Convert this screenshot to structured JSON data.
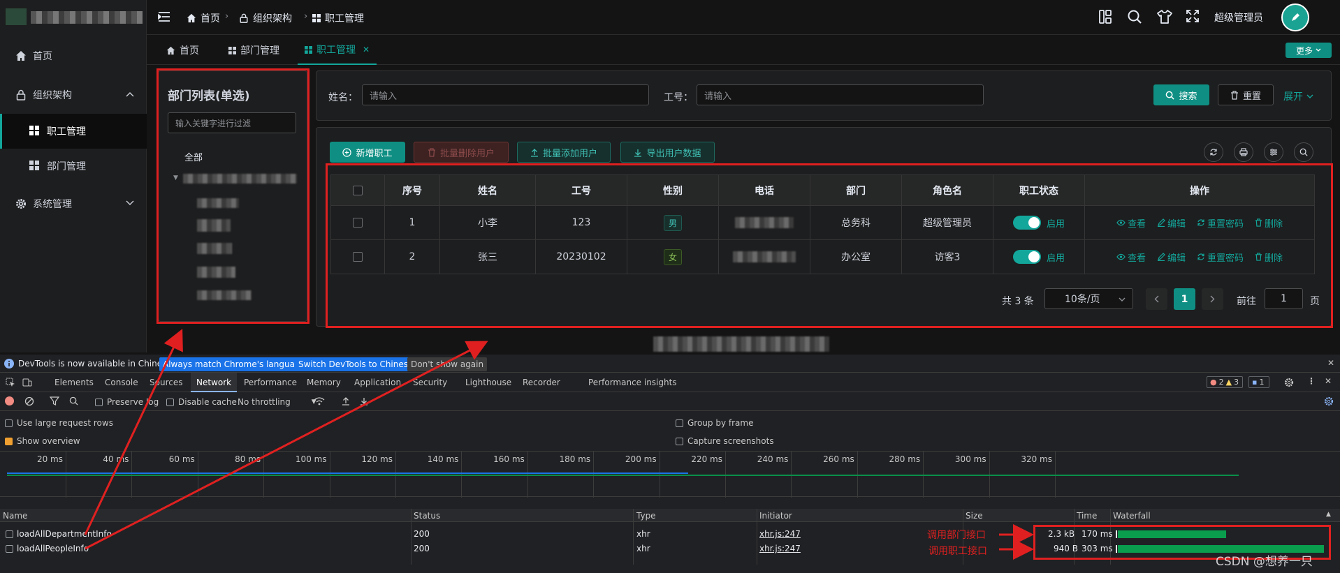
{
  "sidebar": {
    "items": [
      {
        "label": "首页",
        "icon": "home-icon"
      },
      {
        "label": "组织架构",
        "icon": "lock-icon"
      },
      {
        "label": "职工管理",
        "icon": "grid-icon"
      },
      {
        "label": "部门管理",
        "icon": "grid-icon"
      },
      {
        "label": "系统管理",
        "icon": "gear-icon"
      }
    ]
  },
  "header": {
    "breadcrumbs": [
      "首页",
      "组织架构",
      "职工管理"
    ],
    "user_name": "超级管理员"
  },
  "tabs": {
    "items": [
      "首页",
      "部门管理",
      "职工管理"
    ],
    "more_label": "更多"
  },
  "dept_panel": {
    "title": "部门列表(单选)",
    "filter_placeholder": "输入关键字进行过滤",
    "root_label": "全部"
  },
  "search": {
    "name_label": "姓名：",
    "name_placeholder": "请输入",
    "id_label": "工号：",
    "id_placeholder": "请输入",
    "search_label": "搜索",
    "reset_label": "重置",
    "expand_label": "展开"
  },
  "toolbar": {
    "add_label": "新增职工",
    "batch_delete_label": "批量删除用户",
    "batch_add_label": "批量添加用户",
    "export_label": "导出用户数据"
  },
  "table": {
    "columns": [
      "序号",
      "姓名",
      "工号",
      "性别",
      "电话",
      "部门",
      "角色名",
      "职工状态",
      "操作"
    ],
    "rows": [
      {
        "index": "1",
        "name": "小李",
        "id": "123",
        "gender": "男",
        "dept": "总务科",
        "role": "超级管理员",
        "status": "启用"
      },
      {
        "index": "2",
        "name": "张三",
        "id": "20230102",
        "gender": "女",
        "dept": "办公室",
        "role": "访客3",
        "status": "启用"
      }
    ],
    "ops": [
      "查看",
      "编辑",
      "重置密码",
      "删除"
    ]
  },
  "pagination": {
    "total": "共 3 条",
    "page_size": "10条/页",
    "current": "1",
    "goto_label": "前往",
    "goto_value": "1",
    "page_suffix": "页"
  },
  "devtools": {
    "notice": "DevTools is now available in Chinese!",
    "btn_always": "Always match Chrome's language",
    "btn_switch": "Switch DevTools to Chinese",
    "btn_dont": "Don't show again",
    "tabs": [
      "Elements",
      "Console",
      "Sources",
      "Network",
      "Performance",
      "Memory",
      "Application",
      "Security",
      "Lighthouse",
      "Recorder",
      "Performance insights"
    ],
    "errors": "2",
    "warnings": "3",
    "messages": "1",
    "preserve_log": "Preserve log",
    "disable_cache": "Disable cache",
    "throttling": "No throttling",
    "large_rows": "Use large request rows",
    "show_overview": "Show overview",
    "group_by_frame": "Group by frame",
    "capture_screenshots": "Capture screenshots",
    "ticks": [
      "20 ms",
      "40 ms",
      "60 ms",
      "80 ms",
      "100 ms",
      "120 ms",
      "140 ms",
      "160 ms",
      "180 ms",
      "200 ms",
      "220 ms",
      "240 ms",
      "260 ms",
      "280 ms",
      "300 ms",
      "320 ms"
    ],
    "columns": [
      "Name",
      "Status",
      "Type",
      "Initiator",
      "Size",
      "Time",
      "Waterfall"
    ],
    "requests": [
      {
        "name": "loadAllDepartmentInfo",
        "status": "200",
        "type": "xhr",
        "initiator": "xhr.js:247",
        "size": "2.3 kB",
        "time": "170 ms",
        "fraction": 0.52
      },
      {
        "name": "loadAllPeopleInfo",
        "status": "200",
        "type": "xhr",
        "initiator": "xhr.js:247",
        "size": "940 B",
        "time": "303 ms",
        "fraction": 0.99
      }
    ]
  },
  "annotations": {
    "note_dept": "调用部门接口",
    "note_people": "调用职工接口"
  },
  "watermark": "CSDN @想养一只"
}
